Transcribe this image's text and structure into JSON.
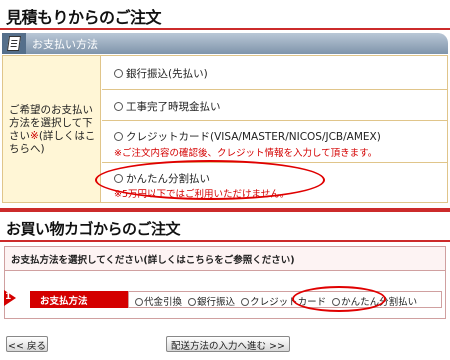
{
  "section1": {
    "title": "見積もりからのご注文",
    "bar_label": "お支払い方法",
    "left_text": "ご希望のお支払い方法を選択して下さい",
    "left_mark": "※",
    "left_link": "(詳しくはこちらへ)",
    "options": [
      {
        "label": "銀行振込(先払い)"
      },
      {
        "label": "工事完了時現金払い"
      },
      {
        "label": "クレジットカード(VISA/MASTER/NICOS/JCB/AMEX)",
        "note": "※ご注文内容の確認後、クレジット情報を入力して頂きます。"
      },
      {
        "label": "かんたん分割払い",
        "note": "※5万円以下ではご利用いただけません。"
      }
    ]
  },
  "section2": {
    "title": "お買い物カゴからのご注文",
    "instruction": "お支払方法を選択してください(詳しくはこちらをご参照ください)",
    "step_number": "1",
    "row_label": "お支払方法",
    "options": [
      "代金引換",
      "銀行振込",
      "クレジットカード",
      "かんたん分割払い"
    ]
  },
  "buttons": {
    "back": "<< 戻る",
    "next": "配送方法の入力へ進む >>"
  },
  "colors": {
    "accent": "#cc2b2b",
    "highlight": "#e00000",
    "note": "#d40000"
  },
  "icons": {
    "bar_icon": "document-icon"
  }
}
